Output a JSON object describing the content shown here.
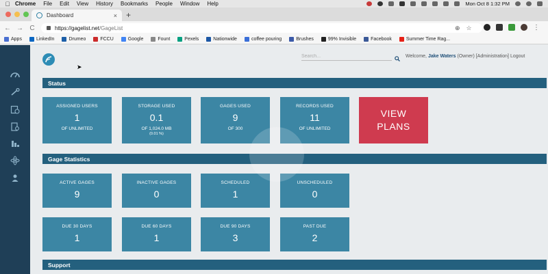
{
  "menubar": {
    "items": [
      "Chrome",
      "File",
      "Edit",
      "View",
      "History",
      "Bookmarks",
      "People",
      "Window",
      "Help"
    ],
    "clock": "Mon Oct 8  1:32 PM"
  },
  "browser": {
    "tab_title": "Dashboard",
    "tab_close": "×",
    "new_tab": "+",
    "url_host": "https://gagelist.net",
    "url_path": "/GageList",
    "nav": {
      "back": "←",
      "forward": "→",
      "reload": "C"
    },
    "omni_icons": {
      "zoom": "⊕",
      "star": "☆"
    },
    "bookmarks": [
      {
        "label": "Apps",
        "color": "#4a6fd1"
      },
      {
        "label": "LinkedIn",
        "color": "#0a66c2"
      },
      {
        "label": "Drumeo",
        "color": "#1d5fa8"
      },
      {
        "label": "FCCU",
        "color": "#cc2b2b"
      },
      {
        "label": "Google",
        "color": "#4285f4"
      },
      {
        "label": "Fount",
        "color": "#888888"
      },
      {
        "label": "Pexels",
        "color": "#05a081"
      },
      {
        "label": "Nationwide",
        "color": "#1c57a5"
      },
      {
        "label": "coffee pouring",
        "color": "#3b6fd8"
      },
      {
        "label": "Brushes",
        "color": "#3c5aa8"
      },
      {
        "label": "99% Invisible",
        "color": "#222222"
      },
      {
        "label": "Facebook",
        "color": "#3b5998"
      },
      {
        "label": "Summer Time Rag...",
        "color": "#e62117"
      }
    ]
  },
  "header": {
    "search_placeholder": "Search...",
    "welcome_prefix": "Welcome,",
    "user_name": "Jake Waters",
    "welcome_suffix": "(Owner) [Administration]",
    "logout": "Logout"
  },
  "status": {
    "title": "Status",
    "cards": [
      {
        "title": "ASSIGNED USERS",
        "value": "1",
        "sub": "OF UNLIMITED",
        "sub2": ""
      },
      {
        "title": "STORAGE USED",
        "value": "0.1",
        "sub": "OF 1,024.0 MB",
        "sub2": "(0.01 %)"
      },
      {
        "title": "GAGES USED",
        "value": "9",
        "sub": "OF 300",
        "sub2": ""
      },
      {
        "title": "RECORDS USED",
        "value": "11",
        "sub": "OF UNLIMITED",
        "sub2": ""
      }
    ],
    "view_plans_line1": "VIEW",
    "view_plans_line2": "PLANS"
  },
  "gage_statistics": {
    "title": "Gage Statistics",
    "row1": [
      {
        "title": "ACTIVE GAGES",
        "value": "9"
      },
      {
        "title": "INACTIVE GAGES",
        "value": "0"
      },
      {
        "title": "SCHEDULED",
        "value": "1"
      },
      {
        "title": "UNSCHEDULED",
        "value": "0"
      }
    ],
    "row2": [
      {
        "title": "DUE 30 DAYS",
        "value": "1"
      },
      {
        "title": "DUE 60 DAYS",
        "value": "1"
      },
      {
        "title": "DUE 90 DAYS",
        "value": "3"
      },
      {
        "title": "PAST DUE",
        "value": "2"
      }
    ]
  },
  "support": {
    "title": "Support"
  },
  "colors": {
    "sidebar": "#1f3f57",
    "section_bar": "#24607e",
    "card": "#3c86a4",
    "view_plans": "#cf3b4f"
  }
}
